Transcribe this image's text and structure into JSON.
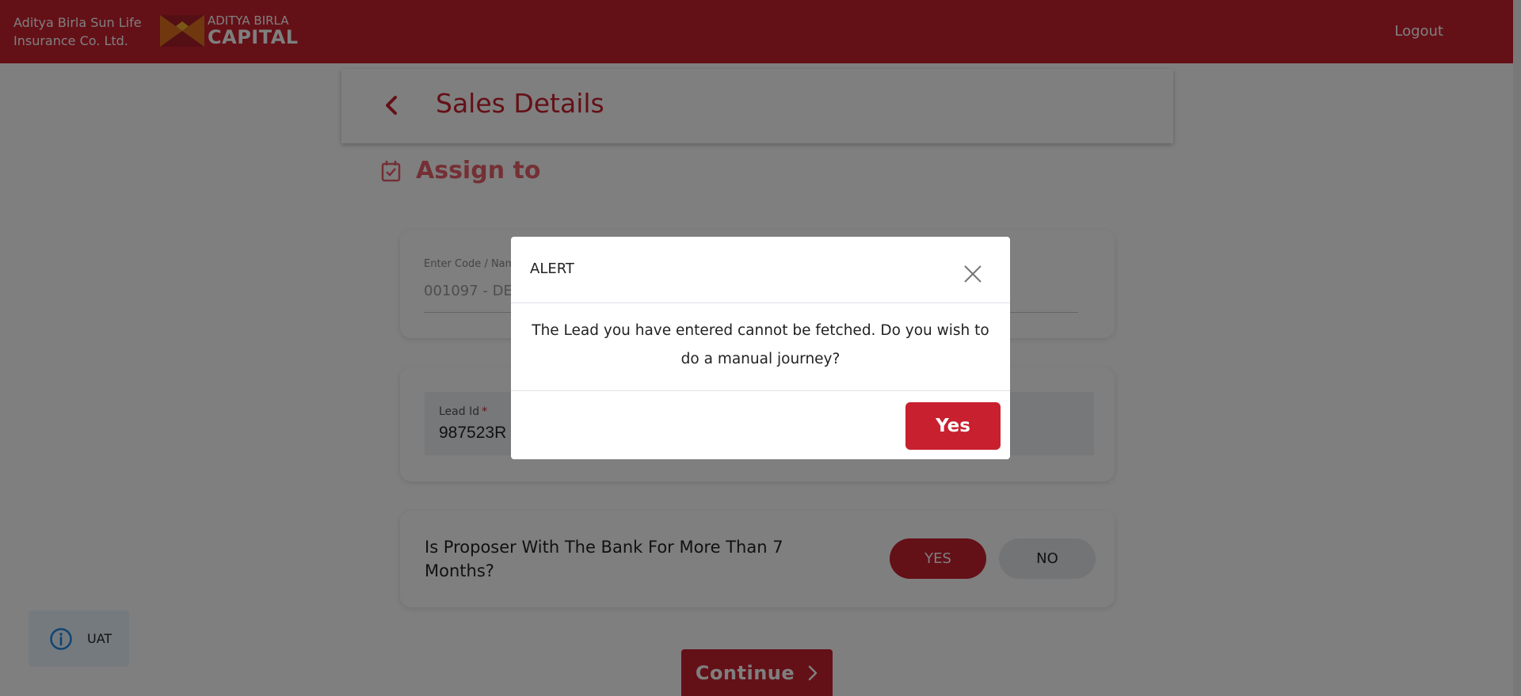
{
  "header": {
    "company_line1": "Aditya Birla Sun Life",
    "company_line2": "Insurance Co. Ltd.",
    "logo_line1": "ADITYA BIRLA",
    "logo_line2": "CAPITAL",
    "logout_label": "Logout"
  },
  "page": {
    "title": "Sales Details",
    "section_title": "Assign to"
  },
  "code_field": {
    "label": "Enter Code / Name",
    "value": "001097 - DE"
  },
  "lead_field": {
    "label": "Lead Id",
    "required_marker": "*",
    "value": "987523R"
  },
  "question": {
    "text": "Is Proposer With The Bank For More Than 7 Months?",
    "yes_label": "YES",
    "no_label": "NO",
    "selected": "YES"
  },
  "continue_label": "Continue",
  "env_badge": {
    "label": "UAT"
  },
  "modal": {
    "title": "ALERT",
    "message": "The Lead you have entered cannot be fetched. Do you wish to do a manual journey?",
    "confirm_label": "Yes"
  },
  "colors": {
    "brand_red": "#c8202f",
    "overlay": "rgba(0,0,0,0.5)",
    "badge_bg": "#eaf5ff",
    "info_blue": "#1e88e5"
  },
  "icons": {
    "back": "chevron-left-icon",
    "section": "checkbox-icon",
    "continue": "chevron-right-icon",
    "badge": "info-icon",
    "close": "close-icon"
  }
}
